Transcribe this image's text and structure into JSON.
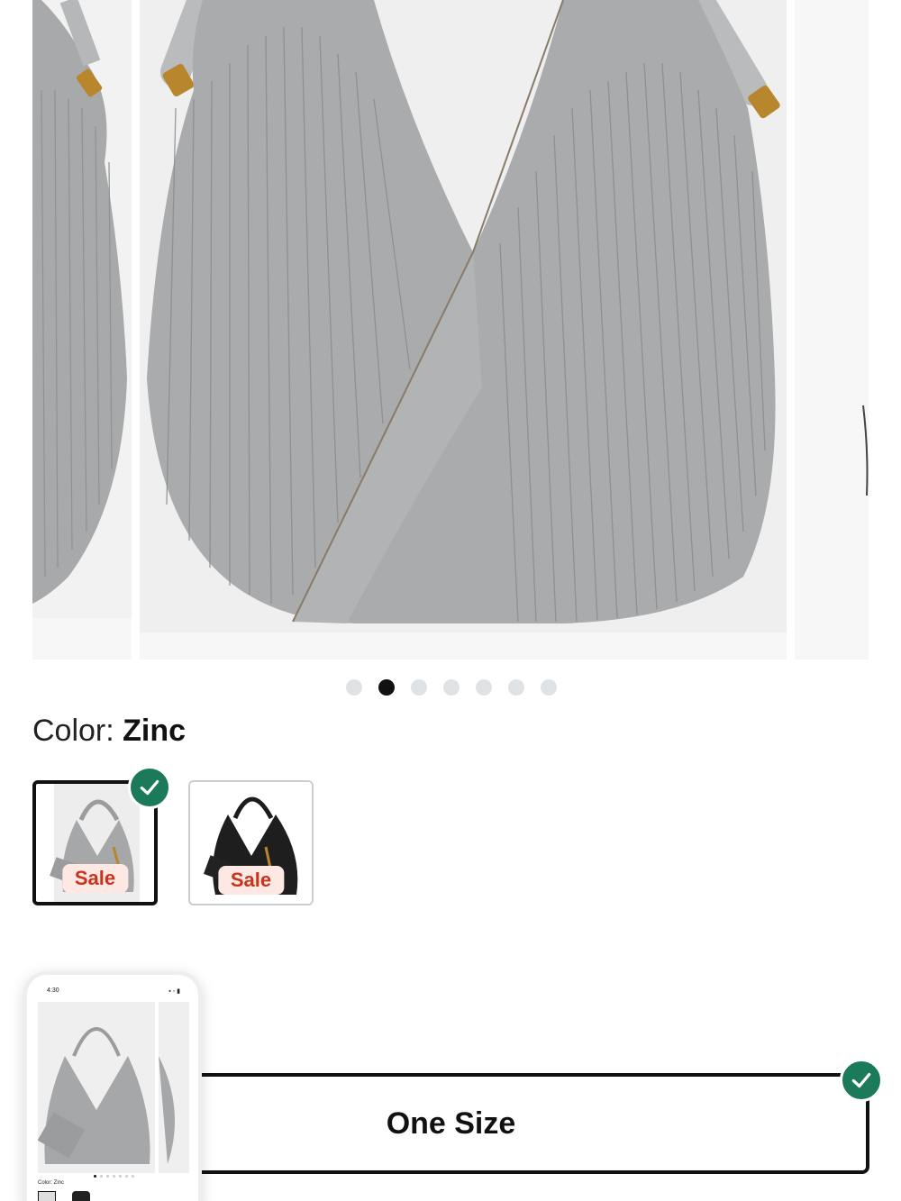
{
  "carousel": {
    "slide_count": 7,
    "active_index": 1,
    "product_color": "#a8aaab"
  },
  "color": {
    "label_prefix": "Color:",
    "selected_name": "Zinc",
    "options": [
      {
        "name": "Zinc",
        "badge": "Sale",
        "selected": true,
        "swatch_color": "#a8aaab"
      },
      {
        "name": "Black",
        "badge": "Sale",
        "selected": false,
        "swatch_color": "#1a1a1a"
      }
    ]
  },
  "size": {
    "label_visible": "ze",
    "options": [
      {
        "label": "One Size",
        "selected": true
      }
    ]
  },
  "preview": {
    "time": "4:30",
    "color_label": "Color: Zinc"
  },
  "colors": {
    "accent_check": "#1b7a5a",
    "sale_text": "#c8341b",
    "sale_bg": "#fde8e4"
  }
}
